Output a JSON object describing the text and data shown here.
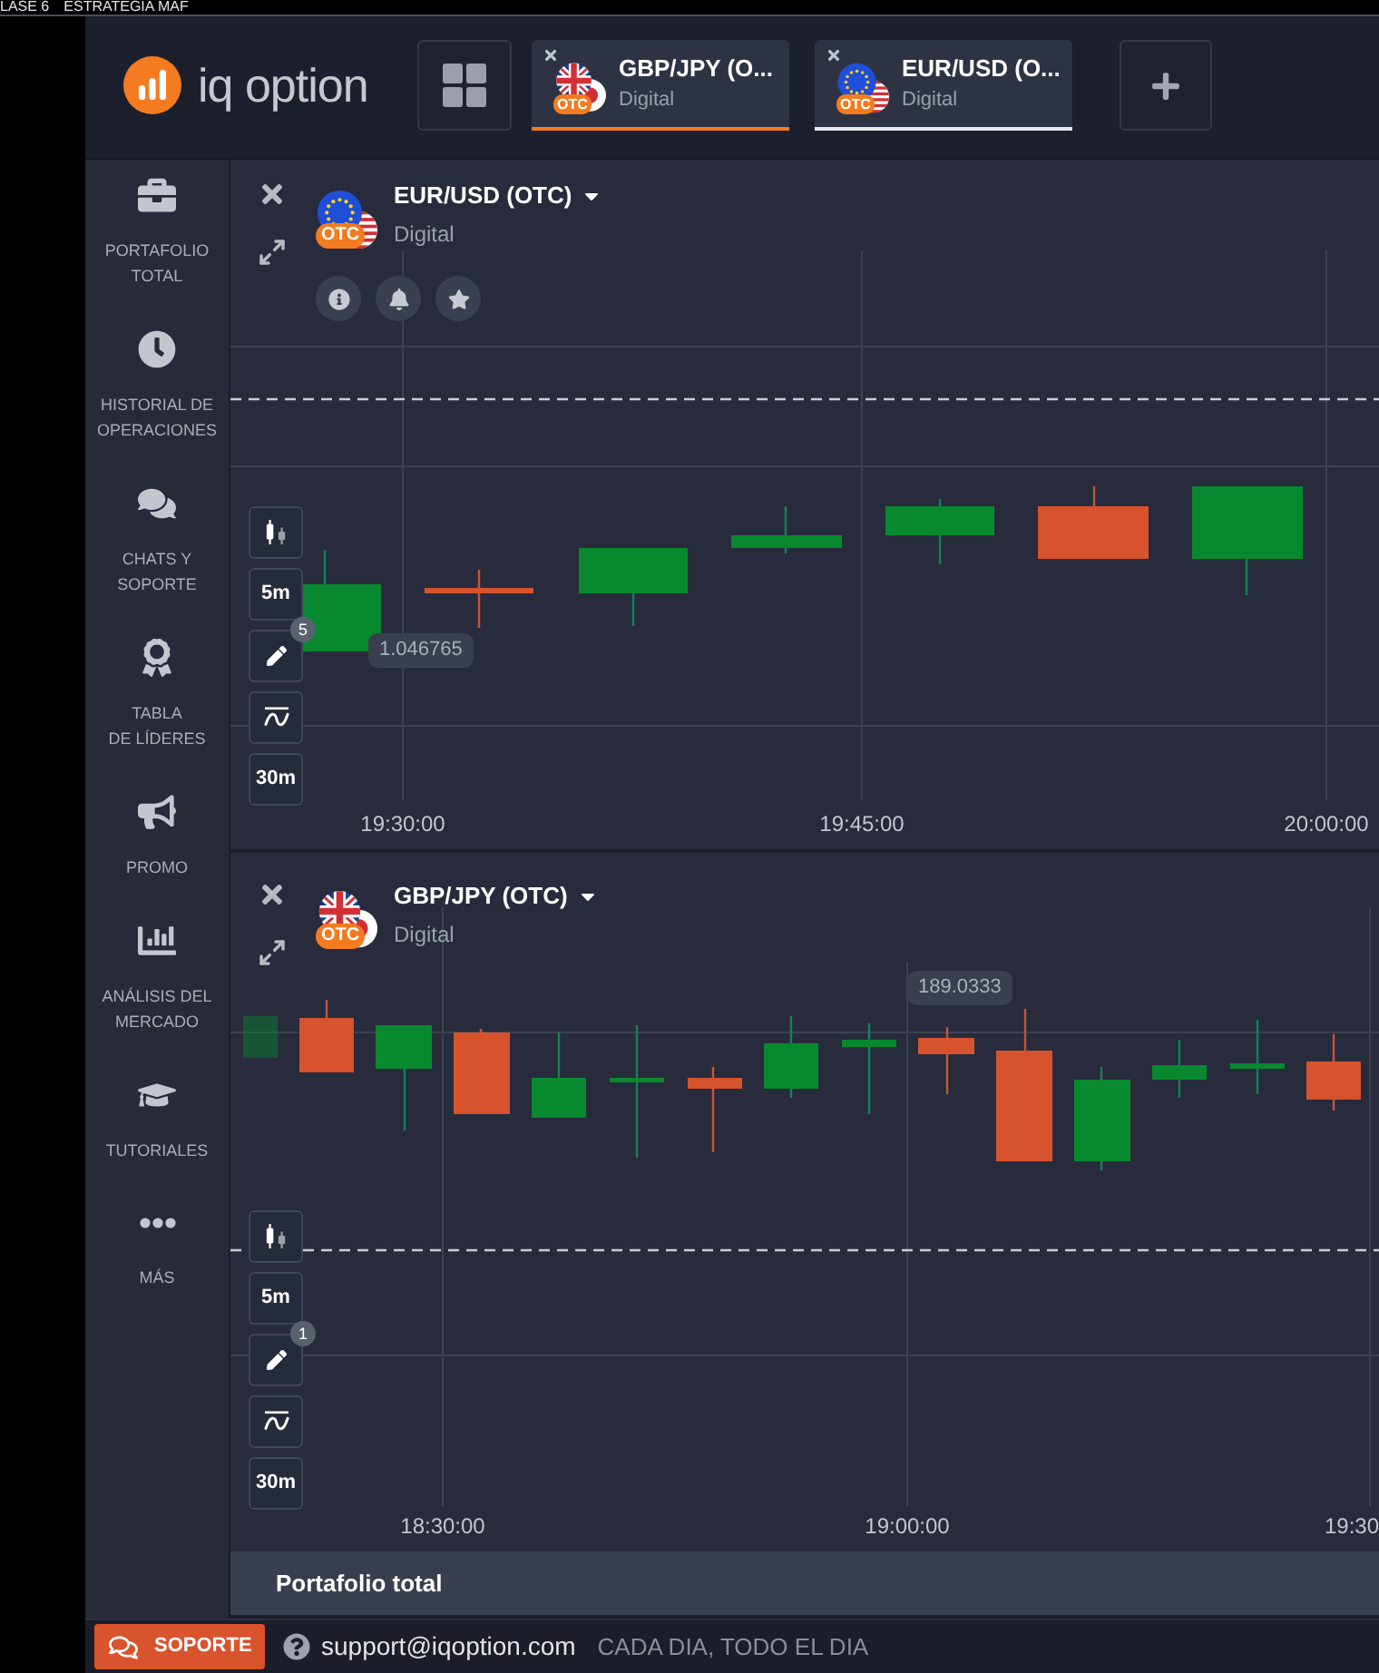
{
  "video_title": [
    "LASE 6",
    "ESTRATEGIA MAF"
  ],
  "header": {
    "logo_text": "iq option",
    "tabs": [
      {
        "title": "GBP/JPY (O...",
        "subtitle": "Digital",
        "badge": "OTC",
        "kind": "gbp-jpy",
        "selected": true
      },
      {
        "title": "EUR/USD (O...",
        "subtitle": "Digital",
        "badge": "OTC",
        "kind": "eur-usd",
        "selected": false
      }
    ]
  },
  "sidebar": {
    "items": [
      {
        "kind": "portfolio",
        "label": "PORTAFOLIO\nTOTAL",
        "selected": false
      },
      {
        "kind": "history",
        "label": "HISTORIAL DE\nOPERACIONES",
        "selected": false
      },
      {
        "kind": "chat",
        "label": "CHATS Y\nSOPORTE",
        "selected": false
      },
      {
        "kind": "leaders",
        "label": "TABLA\nDE LÍDERES",
        "selected": false
      },
      {
        "kind": "promo",
        "label": "PROMO",
        "selected": false
      },
      {
        "kind": "analysis",
        "label": "ANÁLISIS DEL\nMERCADO",
        "selected": false
      },
      {
        "kind": "tutorials",
        "label": "TUTORIALES",
        "selected": false
      },
      {
        "kind": "more",
        "label": "MÁS",
        "selected": false
      }
    ]
  },
  "charts": [
    {
      "title": "EUR/USD (OTC)",
      "subtitle": "Digital",
      "badge": "OTC",
      "kind": "eur-usd",
      "actions": [
        {
          "kind": "info"
        },
        {
          "kind": "bell"
        },
        {
          "kind": "star"
        }
      ],
      "tools": [
        {
          "kind": "chart-type"
        },
        {
          "kind": "period",
          "label": "5m"
        },
        {
          "kind": "draw",
          "count": "5"
        },
        {
          "kind": "indicator"
        },
        {
          "kind": "period",
          "label": "30m"
        }
      ],
      "price_tag": "1.046765",
      "time_labels": [
        "19:30:00",
        "19:45:00",
        "20:00:00"
      ]
    },
    {
      "title": "GBP/JPY (OTC)",
      "subtitle": "Digital",
      "badge": "OTC",
      "kind": "gbp-jpy",
      "tools": [
        {
          "kind": "chart-type"
        },
        {
          "kind": "period",
          "label": "5m"
        },
        {
          "kind": "draw",
          "count": "1"
        },
        {
          "kind": "indicator"
        },
        {
          "kind": "period",
          "label": "30m"
        }
      ],
      "price_tag": "189.0333",
      "time_labels": [
        "18:30:00",
        "19:00:00",
        "19:30"
      ]
    }
  ],
  "portfolio_bar": {
    "label": "Portafolio total"
  },
  "footer": {
    "support_button": "SOPORTE",
    "email": "support@iqoption.com",
    "hours": "CADA DIA, TODO EL DIA"
  }
}
